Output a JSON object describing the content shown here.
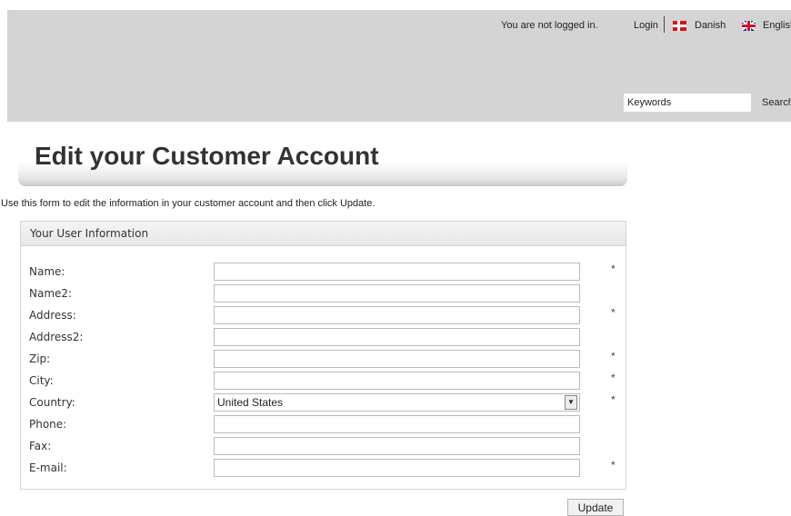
{
  "header": {
    "status_text": "You are not logged in.",
    "login_label": "Login",
    "languages": [
      {
        "label": "Danish",
        "icon": "danish-flag-icon"
      },
      {
        "label": "English",
        "icon": "uk-flag-icon"
      }
    ],
    "search": {
      "placeholder": "Keywords",
      "button_label": "Search"
    }
  },
  "page": {
    "title": "Edit your Customer Account",
    "intro": "Use this form to edit the information in your customer account and then click Update."
  },
  "form": {
    "panel_title": "Your User Information",
    "required_marker": "*",
    "fields": [
      {
        "label": "Name:",
        "value": "",
        "required": true
      },
      {
        "label": "Name2:",
        "value": "",
        "required": false
      },
      {
        "label": "Address:",
        "value": "",
        "required": true
      },
      {
        "label": "Address2:",
        "value": "",
        "required": false
      },
      {
        "label": "Zip:",
        "value": "",
        "required": true
      },
      {
        "label": "City:",
        "value": "",
        "required": true
      },
      {
        "label": "Country:",
        "value": "United States",
        "required": true,
        "type": "select"
      },
      {
        "label": "Phone:",
        "value": "",
        "required": false
      },
      {
        "label": "Fax:",
        "value": "",
        "required": false
      },
      {
        "label": "E-mail:",
        "value": "",
        "required": true
      }
    ],
    "submit_label": "Update"
  }
}
